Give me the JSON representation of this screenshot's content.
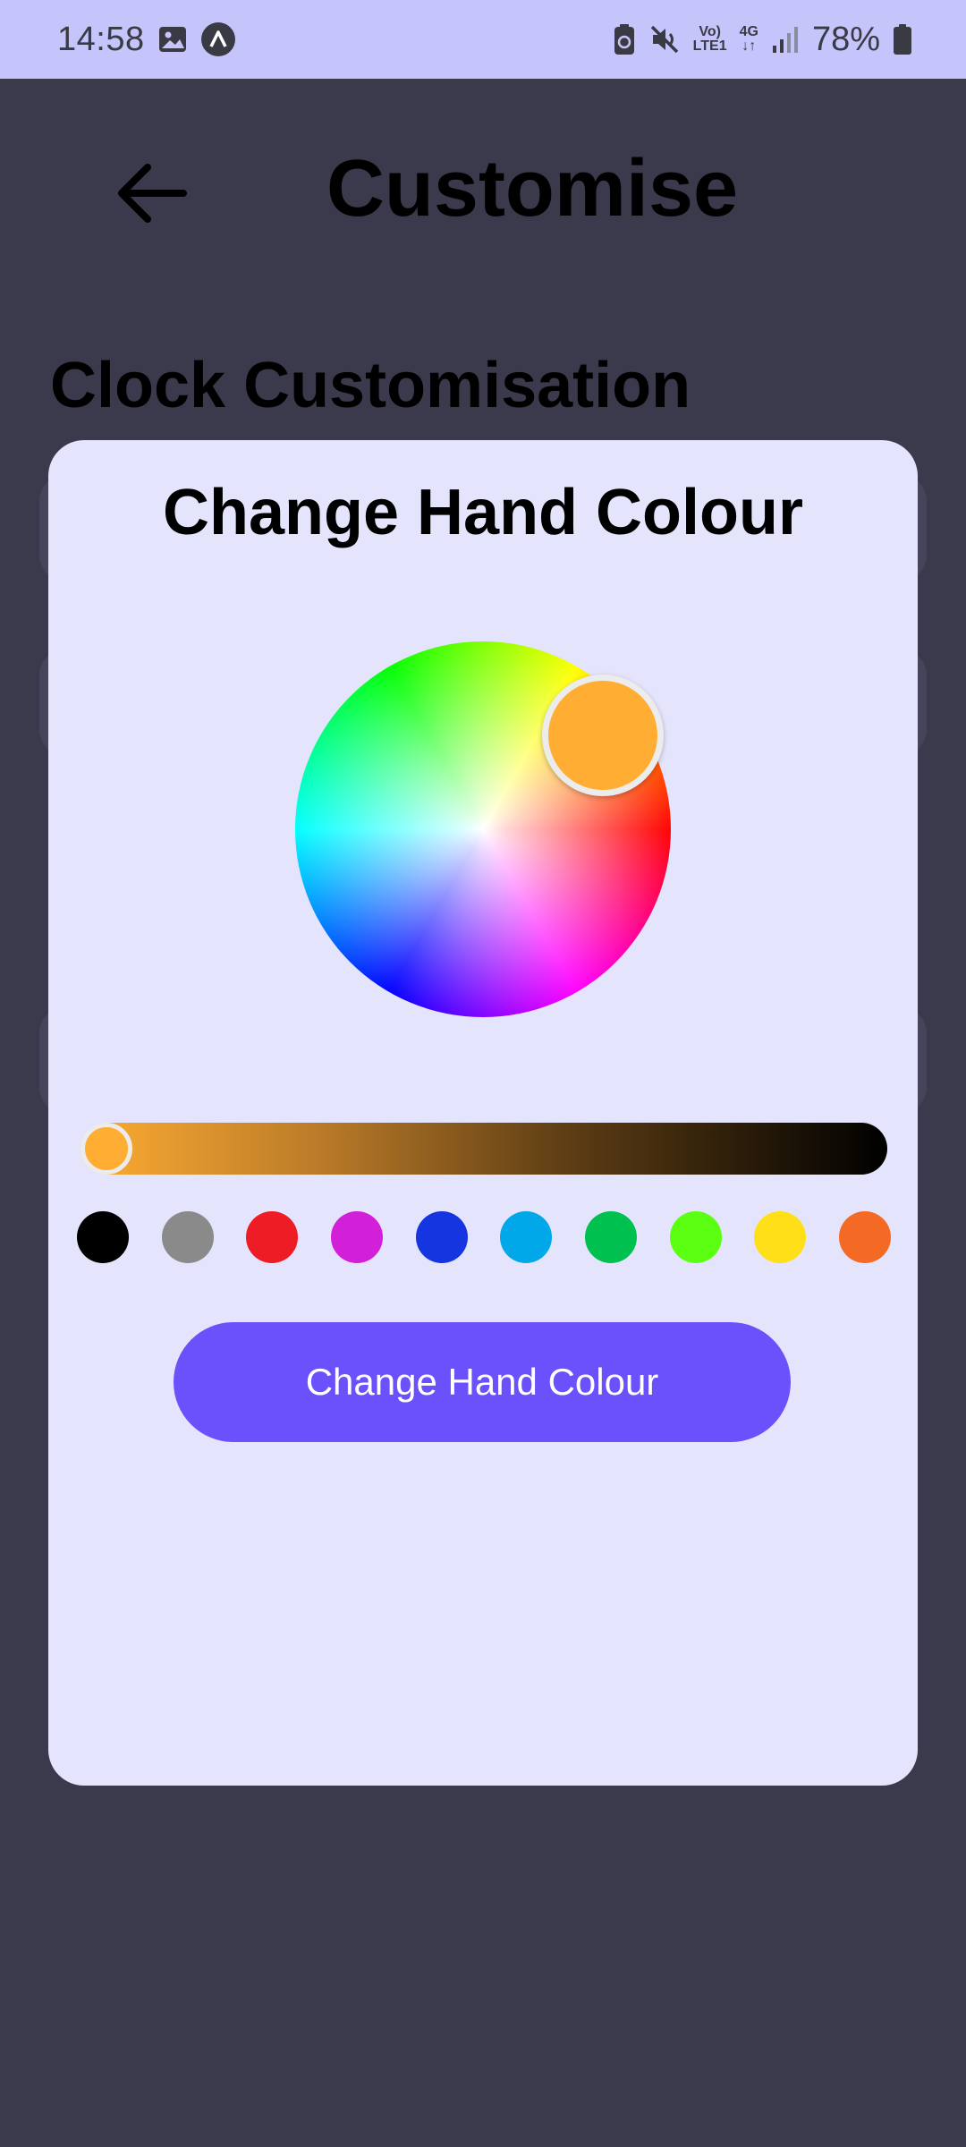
{
  "status_bar": {
    "time": "14:58",
    "battery_pct": "78%",
    "network_volte": "Vo)",
    "network_lte": "LTE1",
    "network_4g": "4G",
    "icons": [
      "gallery-icon",
      "app-icon",
      "battery-saver-icon",
      "mute-icon",
      "volte-icon",
      "4g-icon",
      "signal-icon",
      "battery-icon"
    ]
  },
  "header": {
    "back_icon": "arrow-left-icon",
    "title": "Customise"
  },
  "section": {
    "title": "Clock Customisation"
  },
  "dialog": {
    "title": "Change Hand Colour",
    "selected_color": "#ffad33",
    "brightness_value": 0,
    "swatches": [
      {
        "name": "black",
        "color": "#000000"
      },
      {
        "name": "grey",
        "color": "#8a8a8a"
      },
      {
        "name": "red",
        "color": "#ee1c25"
      },
      {
        "name": "magenta",
        "color": "#d21fd8"
      },
      {
        "name": "blue",
        "color": "#1535e0"
      },
      {
        "name": "light-blue",
        "color": "#00a8ea"
      },
      {
        "name": "green",
        "color": "#00c050"
      },
      {
        "name": "lime",
        "color": "#5bff12"
      },
      {
        "name": "yellow",
        "color": "#ffdf18"
      },
      {
        "name": "orange",
        "color": "#f46a25"
      }
    ],
    "button_label": "Change Hand Colour"
  },
  "colors": {
    "status_bar_bg": "#c5c4fb",
    "scrim": "#3b3a4d",
    "dialog_bg": "#e5e4fd",
    "accent": "#6b51fb"
  }
}
